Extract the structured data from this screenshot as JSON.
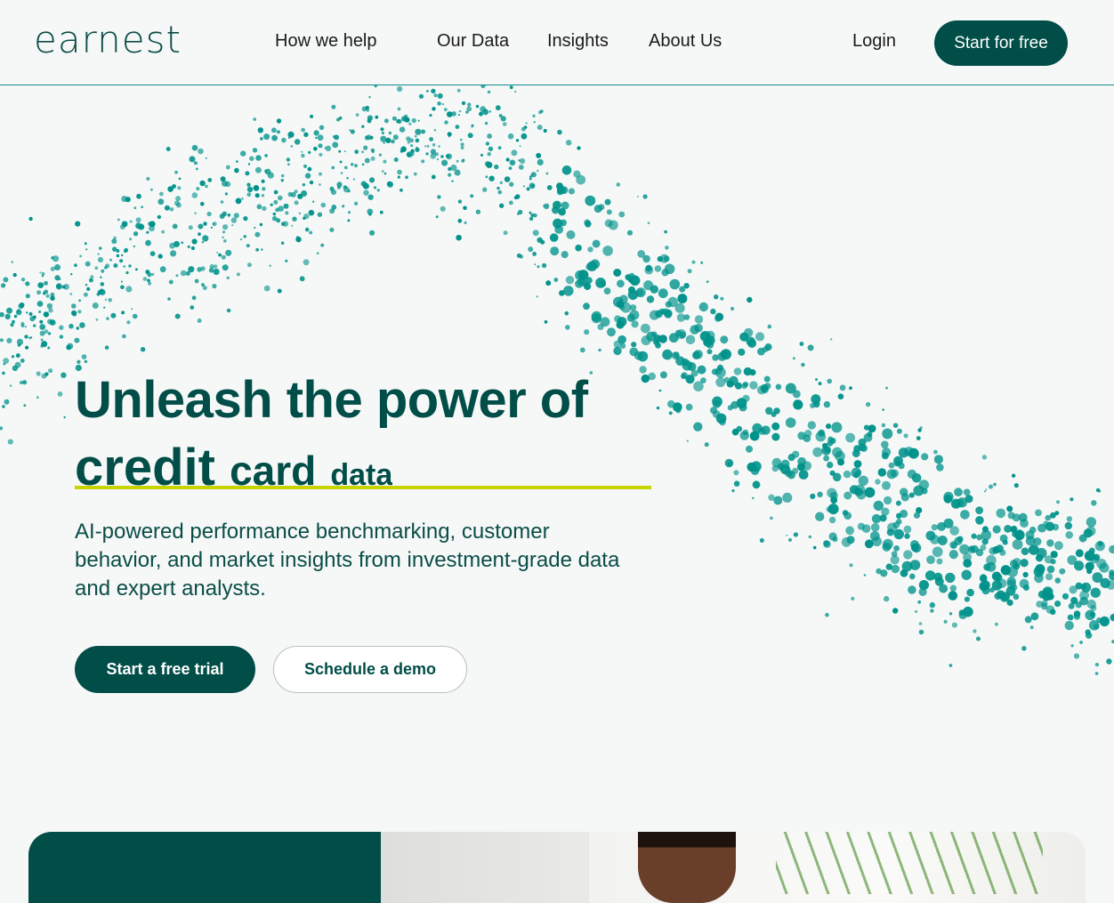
{
  "nav": {
    "logo": "earnest",
    "links": [
      {
        "label": "How we help"
      },
      {
        "label": "Our Data"
      },
      {
        "label": "Insights"
      },
      {
        "label": "About Us"
      }
    ],
    "login": "Login",
    "cta": "Start for free"
  },
  "hero": {
    "title_line1": "Unleash the power of",
    "title_line2_words": [
      "credit",
      "card",
      "data"
    ],
    "subtitle": "AI-powered performance benchmarking, customer behavior, and market insights from investment-grade data and expert analysts.",
    "primary_cta": "Start a free trial",
    "secondary_cta": "Schedule a demo"
  },
  "colors": {
    "brand": "#014d47",
    "accent_dots": "#00928a",
    "underline": "#c8d400",
    "background": "#f6f8f8"
  },
  "decorations": {
    "background_graphic": "teal-particle-wave"
  }
}
